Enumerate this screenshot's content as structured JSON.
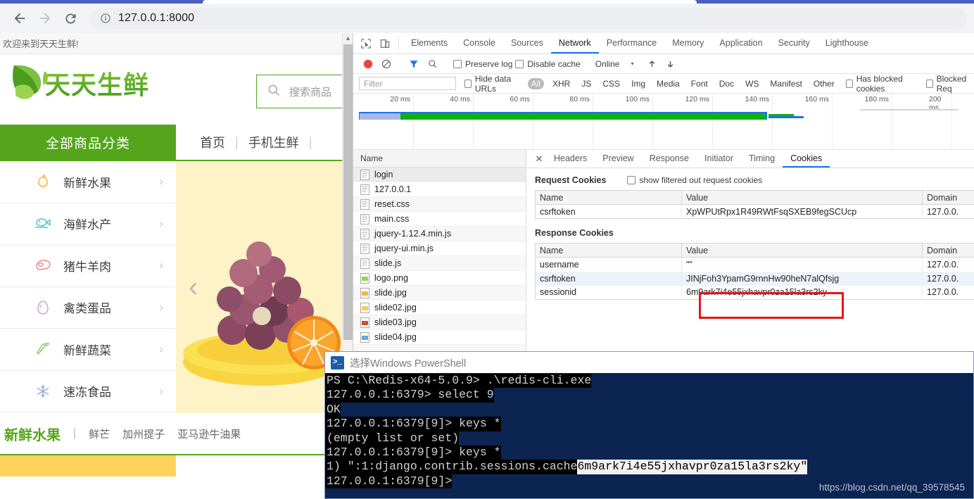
{
  "browser": {
    "back_icon": "back-arrow-icon",
    "forward_icon": "forward-arrow-icon",
    "reload_icon": "reload-icon",
    "info_icon": "info-circle-icon",
    "url": "127.0.0.1:8000"
  },
  "site": {
    "welcome": "欢迎来到天天生鲜!",
    "logo_text": "天天生鲜",
    "search_placeholder": "搜索商品",
    "nav": {
      "all_categories": "全部商品分类",
      "links": [
        "首页",
        "|",
        "手机生鲜",
        "|"
      ]
    },
    "categories": [
      {
        "label": "新鲜水果",
        "icon": "apple-icon",
        "color": "#f5b731",
        "chevron": "›"
      },
      {
        "label": "海鲜水产",
        "icon": "fish-icon",
        "color": "#4ec5e0",
        "chevron": "›"
      },
      {
        "label": "猪牛羊肉",
        "icon": "meat-icon",
        "color": "#ef8a8a",
        "chevron": "›"
      },
      {
        "label": "禽类蛋品",
        "icon": "egg-icon",
        "color": "#d39ae0",
        "chevron": "›"
      },
      {
        "label": "新鲜蔬菜",
        "icon": "carrot-icon",
        "color": "#8cc76a",
        "chevron": "›"
      },
      {
        "label": "速冻食品",
        "icon": "snowflake-icon",
        "color": "#9aa8e0",
        "chevron": "›"
      }
    ],
    "banner": {
      "prev_arrow": "‹",
      "image": "fruit-platter-image"
    },
    "bottom": {
      "title": "新鲜水果",
      "sep": "|",
      "links": [
        "鲜芒",
        "加州提子",
        "亚马逊牛油果"
      ]
    }
  },
  "devtools": {
    "inspect_icon": "inspect-element-icon",
    "device_icon": "device-toolbar-icon",
    "tabs": [
      {
        "label": "Elements",
        "active": false
      },
      {
        "label": "Console",
        "active": false
      },
      {
        "label": "Sources",
        "active": false
      },
      {
        "label": "Network",
        "active": true
      },
      {
        "label": "Performance",
        "active": false
      },
      {
        "label": "Memory",
        "active": false
      },
      {
        "label": "Application",
        "active": false
      },
      {
        "label": "Security",
        "active": false
      },
      {
        "label": "Lighthouse",
        "active": false
      }
    ],
    "toolbar": {
      "record_icon": "record-stop-icon",
      "clear_icon": "clear-icon",
      "filter_icon": "filter-funnel-icon",
      "search_icon": "search-icon",
      "preserve_log": "Preserve log",
      "disable_cache": "Disable cache",
      "throttling": "Online",
      "caret": "▾",
      "import_icon": "import-har-icon",
      "export_icon": "export-har-icon"
    },
    "filterbar": {
      "filter_placeholder": "Filter",
      "hide_data_urls": "Hide data URLs",
      "types": [
        "All",
        "XHR",
        "JS",
        "CSS",
        "Img",
        "Media",
        "Font",
        "Doc",
        "WS",
        "Manifest",
        "Other"
      ],
      "active_type": "All",
      "has_blocked_cookies": "Has blocked cookies",
      "blocked_requests": "Blocked Req"
    },
    "overview": {
      "ticks": [
        "20 ms",
        "40 ms",
        "60 ms",
        "80 ms",
        "100 ms",
        "120 ms",
        "140 ms",
        "160 ms",
        "180 ms",
        "200 ms"
      ]
    },
    "requests": {
      "column_header": "Name",
      "rows": [
        {
          "name": "login",
          "type": "doc"
        },
        {
          "name": "127.0.0.1",
          "type": "doc"
        },
        {
          "name": "reset.css",
          "type": "doc"
        },
        {
          "name": "main.css",
          "type": "doc"
        },
        {
          "name": "jquery-1.12.4.min.js",
          "type": "doc"
        },
        {
          "name": "jquery-ui.min.js",
          "type": "doc"
        },
        {
          "name": "slide.js",
          "type": "doc"
        },
        {
          "name": "logo.png",
          "type": "img-green"
        },
        {
          "name": "slide.jpg",
          "type": "img-yellow"
        },
        {
          "name": "slide02.jpg",
          "type": "img-yellow"
        },
        {
          "name": "slide03.jpg",
          "type": "img-red"
        },
        {
          "name": "slide04.jpg",
          "type": "img-blue"
        }
      ]
    },
    "detail": {
      "close_icon": "close-icon",
      "tabs": [
        {
          "label": "Headers",
          "active": false
        },
        {
          "label": "Preview",
          "active": false
        },
        {
          "label": "Response",
          "active": false
        },
        {
          "label": "Initiator",
          "active": false
        },
        {
          "label": "Timing",
          "active": false
        },
        {
          "label": "Cookies",
          "active": true
        }
      ],
      "request_cookies_title": "Request Cookies",
      "show_filtered_label": "show filtered out request cookies",
      "response_cookies_title": "Response Cookies",
      "columns": [
        "Name",
        "Value",
        "Domain"
      ],
      "request_cookies": [
        {
          "name": "csrftoken",
          "value": "XpWPUtRpx1R49RWtFsqSXEB9fegSCUcp",
          "domain": "127.0.0."
        }
      ],
      "response_cookies": [
        {
          "name": "username",
          "value": "\"\"",
          "domain": "127.0.0."
        },
        {
          "name": "csrftoken",
          "value": "JINjFoh3YpamG9rnnHw90heN7alQfsjg",
          "domain": "127.0.0."
        },
        {
          "name": "sessionid",
          "value": "6m9ark7i4e55jxhavpr0za15la3rs2ky",
          "domain": "127.0.0."
        }
      ],
      "highlight_color": "#e8151b"
    }
  },
  "powershell": {
    "title": "选择Windows PowerShell",
    "icon": "powershell-icon",
    "lines": [
      {
        "text": "PS C:\\Redis-x64-5.0.9> .\\redis-cli.exe"
      },
      {
        "text": "127.0.0.1:6379> select 9"
      },
      {
        "text": "OK"
      },
      {
        "text": "127.0.0.1:6379[9]> keys *"
      },
      {
        "text": "(empty list or set)"
      },
      {
        "text": "127.0.0.1:6379[9]> keys *"
      },
      {
        "text": "1) \":1:django.contrib.sessions.cache",
        "selected": "6m9ark7i4e55jxhavpr0za15la3rs2ky",
        "after": "\""
      },
      {
        "text": "127.0.0.1:6379[9]>"
      }
    ]
  },
  "watermark": "https://blog.csdn.net/qq_39578545"
}
